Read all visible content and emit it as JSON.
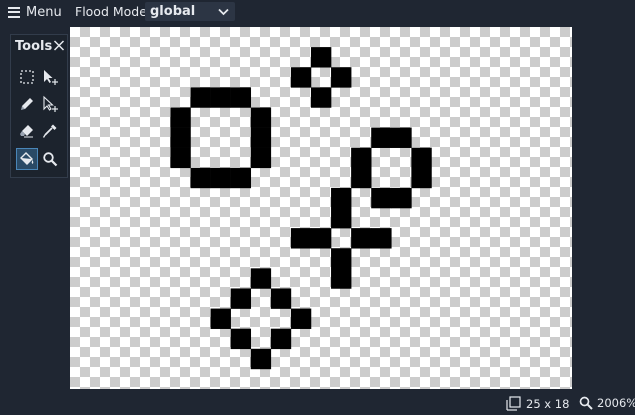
{
  "topbar": {
    "menu_label": "Menu",
    "flood_mode_label": "Flood Mode:",
    "flood_mode_value": "global"
  },
  "tools_panel": {
    "title": "Tools",
    "tools": [
      {
        "name": "rectangle-select",
        "icon": "dashed-rect-icon"
      },
      {
        "name": "move-add",
        "icon": "arrow-plus-icon"
      },
      {
        "name": "pencil",
        "icon": "pencil-icon"
      },
      {
        "name": "select-add",
        "icon": "arrow-plus-outline-icon"
      },
      {
        "name": "eraser",
        "icon": "eraser-icon"
      },
      {
        "name": "eyedropper",
        "icon": "eyedropper-icon"
      },
      {
        "name": "bucket-fill",
        "icon": "bucket-icon",
        "active": true
      },
      {
        "name": "zoom",
        "icon": "magnifier-icon"
      }
    ]
  },
  "canvas": {
    "grid_width": 25,
    "grid_height": 18,
    "pixel_color": "#000000",
    "pixels": [
      [
        12,
        1
      ],
      [
        11,
        2
      ],
      [
        13,
        2
      ],
      [
        12,
        3
      ],
      [
        6,
        3
      ],
      [
        7,
        3
      ],
      [
        8,
        3
      ],
      [
        5,
        4
      ],
      [
        9,
        4
      ],
      [
        5,
        5
      ],
      [
        9,
        5
      ],
      [
        5,
        6
      ],
      [
        9,
        6
      ],
      [
        6,
        7
      ],
      [
        7,
        7
      ],
      [
        8,
        7
      ],
      [
        15,
        5
      ],
      [
        16,
        5
      ],
      [
        14,
        6
      ],
      [
        17,
        6
      ],
      [
        14,
        7
      ],
      [
        17,
        7
      ],
      [
        15,
        8
      ],
      [
        16,
        8
      ],
      [
        13,
        8
      ],
      [
        13,
        9
      ],
      [
        11,
        10
      ],
      [
        12,
        10
      ],
      [
        14,
        10
      ],
      [
        15,
        10
      ],
      [
        13,
        11
      ],
      [
        13,
        12
      ],
      [
        9,
        12
      ],
      [
        8,
        13
      ],
      [
        10,
        13
      ],
      [
        7,
        14
      ],
      [
        11,
        14
      ],
      [
        8,
        15
      ],
      [
        10,
        15
      ],
      [
        9,
        16
      ]
    ]
  },
  "status": {
    "size": "25 x 18",
    "zoom": "2006%"
  },
  "colors": {
    "background": "#1f2632",
    "panel": "#1c232d",
    "active_tool": "#2a4a66"
  }
}
